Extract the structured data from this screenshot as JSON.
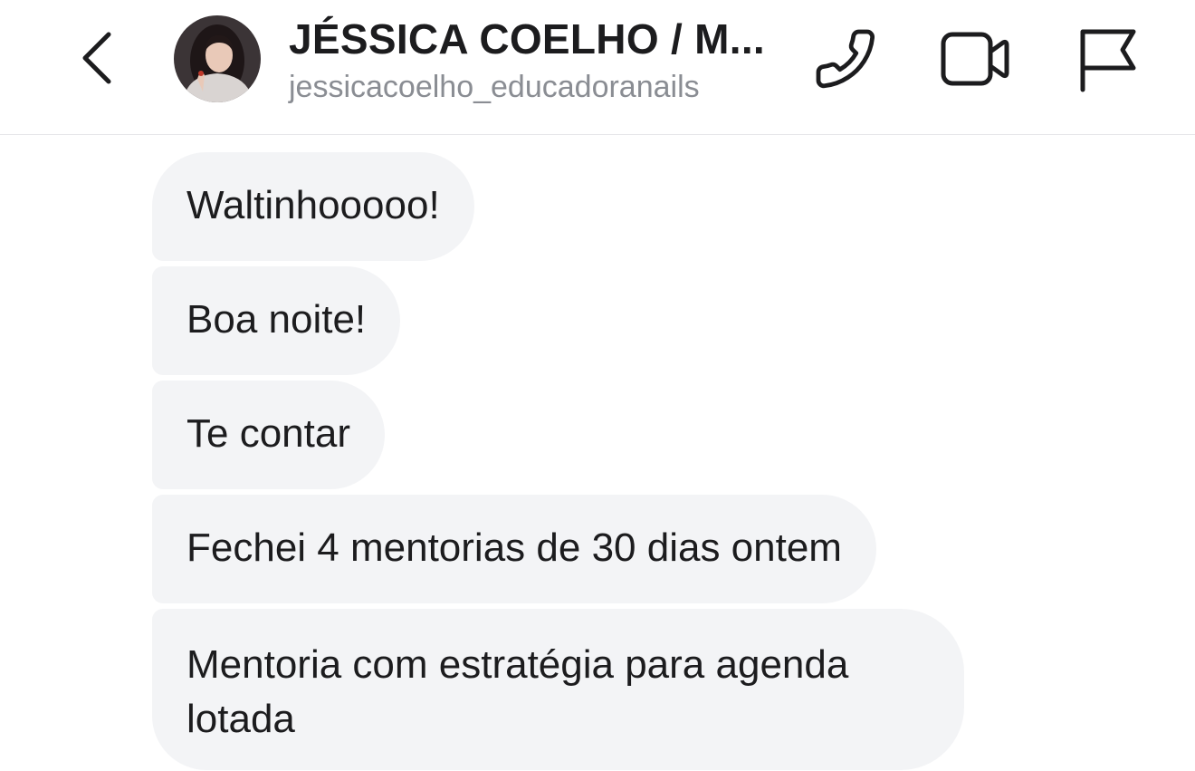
{
  "header": {
    "back_icon": "chevron-left-icon",
    "contact_name": "JÉSSICA COELHO / M...",
    "username": "jessicacoelho_educadoranails",
    "actions": [
      {
        "icon": "phone-icon"
      },
      {
        "icon": "video-camera-icon"
      },
      {
        "icon": "flag-icon"
      }
    ]
  },
  "messages": [
    {
      "text": "Waltinhooooo!"
    },
    {
      "text": "Boa noite!"
    },
    {
      "text": "Te contar"
    },
    {
      "text": "Fechei 4 mentorias de 30 dias ontem"
    },
    {
      "text": "Mentoria com estratégia para agenda lotada"
    }
  ],
  "colors": {
    "bubble_background": "#f3f4f6",
    "text": "#1c1c1e",
    "secondary_text": "#8a8d93",
    "divider": "#e6e6e9"
  }
}
